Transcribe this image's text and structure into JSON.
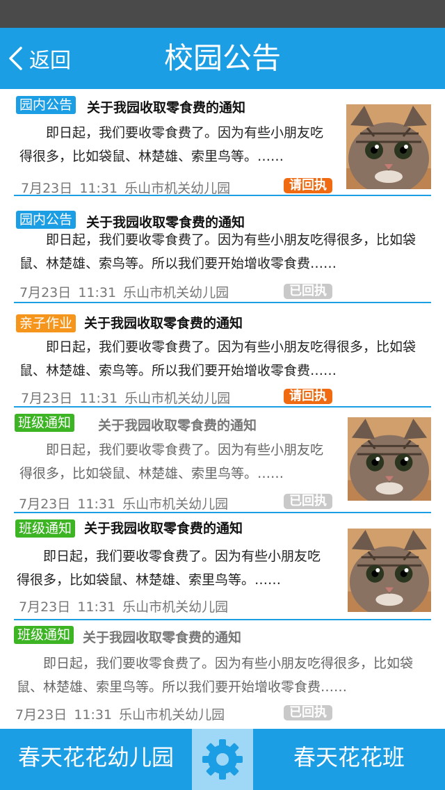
{
  "header": {
    "back_label": "返回",
    "title": "校园公告"
  },
  "notices": [
    {
      "tag": "园内公告",
      "tag_color": "#1c9ee4",
      "title": "关于我园收取零食费的通知",
      "body": "即日起，我们要收零食费了。因为有些小朋友吃得很多，比如袋鼠、林楚雄、索里鸟等。……",
      "date": "7月23日",
      "time": "11:31",
      "school": "乐山市机关幼儿园",
      "receipt": "请回执",
      "receipt_state": "pending",
      "has_image": true,
      "read": false
    },
    {
      "tag": "园内公告",
      "tag_color": "#1c9ee4",
      "title": "关于我园收取零食费的通知",
      "body": "即日起，我们要收零食费了。因为有些小朋友吃得很多，比如袋鼠、林楚雄、索鸟等。所以我们要开始增收零食费……",
      "date": "7月23日",
      "time": "11:31",
      "school": "乐山市机关幼儿园",
      "receipt": "已回执",
      "receipt_state": "done",
      "has_image": false,
      "read": false
    },
    {
      "tag": "亲子作业",
      "tag_color": "#f5951c",
      "title": "关于我园收取零食费的通知",
      "body": "即日起，我们要收零食费了。因为有些小朋友吃得很多，比如袋鼠、林楚雄、索鸟等。所以我们要开始增收零食费……",
      "date": "7月23日",
      "time": "11:31",
      "school": "乐山市机关幼儿园",
      "receipt": "请回执",
      "receipt_state": "pending",
      "has_image": false,
      "read": false
    },
    {
      "tag": "班级通知",
      "tag_color": "#3cb424",
      "title": "关于我园收取零食费的通知",
      "body": "即日起，我们要收零食费了。因为有些小朋友吃得很多，比如袋鼠、林楚雄、索里鸟等。……",
      "date": "7月23日",
      "time": "11:31",
      "school": "乐山市机关幼儿园",
      "receipt": "已回执",
      "receipt_state": "done",
      "has_image": true,
      "read": true
    },
    {
      "tag": "班级通知",
      "tag_color": "#3cb424",
      "title": "关于我园收取零食费的通知",
      "body": "即日起，我们要收零食费了。因为有些小朋友吃得很多，比如袋鼠、林楚雄、索里鸟等。……",
      "date": "7月23日",
      "time": "11:31",
      "school": "乐山市机关幼儿园",
      "receipt": "",
      "receipt_state": "none",
      "has_image": true,
      "read": false
    },
    {
      "tag": "班级通知",
      "tag_color": "#3cb424",
      "title": "关于我园收取零食费的通知",
      "body": "即日起，我们要收零食费了。因为有些小朋友吃得很多，比如袋鼠、林楚雄、索里鸟等。所以我们要开始增收零食费……",
      "date": "7月23日",
      "time": "11:31",
      "school": "乐山市机关幼儿园",
      "receipt": "已回执",
      "receipt_state": "done",
      "has_image": false,
      "read": true
    }
  ],
  "footer": {
    "left_label": "春天花花幼儿园",
    "settings_icon": "gear-icon",
    "right_label": "春天花花班"
  },
  "colors": {
    "primary": "#1c9ee4",
    "receipt_pending": "#f06a12",
    "receipt_done": "#c9c9c9"
  }
}
